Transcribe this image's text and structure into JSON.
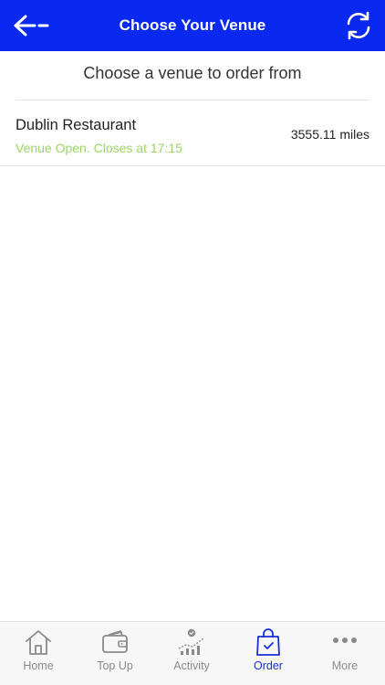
{
  "header": {
    "title": "Choose Your Venue",
    "back_icon": "arrow-left-icon",
    "refresh_icon": "refresh-icon",
    "bg_color": "#0a29f0"
  },
  "main": {
    "subtitle": "Choose a venue to order from",
    "venues": [
      {
        "name": "Dublin Restaurant",
        "status": "Venue Open. Closes at 17:15",
        "distance": "3555.11 miles",
        "status_color": "#9bd46a"
      }
    ]
  },
  "tabbar": {
    "active_color": "#1a2fd6",
    "tabs": [
      {
        "label": "Home",
        "icon": "home-icon"
      },
      {
        "label": "Top Up",
        "icon": "wallet-icon"
      },
      {
        "label": "Activity",
        "icon": "activity-chart-icon"
      },
      {
        "label": "Order",
        "icon": "shopping-bag-icon",
        "active": true
      },
      {
        "label": "More",
        "icon": "more-dots-icon"
      }
    ]
  }
}
